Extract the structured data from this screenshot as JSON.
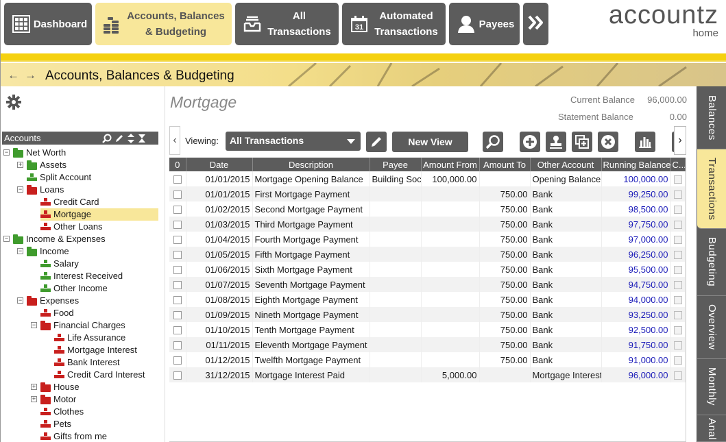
{
  "nav": {
    "buttons": [
      {
        "label": "Dashboard",
        "icon": "dashboard-grid-icon"
      },
      {
        "label": "Accounts, Balances\n& Budgeting",
        "icon": "coins-icon"
      },
      {
        "label": "All\nTransactions",
        "icon": "inbox-tray-icon"
      },
      {
        "label": "Automated\nTransactions",
        "icon": "calendar-31-icon"
      },
      {
        "label": "Payees",
        "icon": "person-icon"
      },
      {
        "label": "",
        "icon": "double-chevron-right-icon"
      }
    ],
    "active": "Accounts, Balances\n& Budgeting"
  },
  "logo": {
    "name": "accountz",
    "sub": "home"
  },
  "breadcrumb": {
    "title": "Accounts, Balances & Budgeting"
  },
  "tree": {
    "header": "Accounts",
    "nodes": [
      {
        "label": "Net Worth",
        "kind": "folder-green",
        "expander": "−",
        "depth": 0
      },
      {
        "label": "Assets",
        "kind": "folder-green",
        "expander": "+",
        "depth": 1
      },
      {
        "label": "Split Account",
        "kind": "acct-green",
        "expander": "",
        "depth": 1
      },
      {
        "label": "Loans",
        "kind": "folder-red",
        "expander": "−",
        "depth": 1
      },
      {
        "label": "Credit Card",
        "kind": "acct-red",
        "expander": "",
        "depth": 2
      },
      {
        "label": "Mortgage",
        "kind": "acct-red",
        "expander": "",
        "depth": 2,
        "selected": true
      },
      {
        "label": "Other Loans",
        "kind": "acct-red",
        "expander": "",
        "depth": 2
      },
      {
        "label": "Income & Expenses",
        "kind": "folder-green",
        "expander": "−",
        "depth": 0
      },
      {
        "label": "Income",
        "kind": "folder-green",
        "expander": "−",
        "depth": 1
      },
      {
        "label": "Salary",
        "kind": "acct-green",
        "expander": "",
        "depth": 2
      },
      {
        "label": "Interest Received",
        "kind": "acct-green",
        "expander": "",
        "depth": 2
      },
      {
        "label": "Other Income",
        "kind": "acct-green",
        "expander": "",
        "depth": 2
      },
      {
        "label": "Expenses",
        "kind": "folder-red",
        "expander": "−",
        "depth": 1
      },
      {
        "label": "Food",
        "kind": "acct-red",
        "expander": "",
        "depth": 2
      },
      {
        "label": "Financial Charges",
        "kind": "folder-red",
        "expander": "−",
        "depth": 2
      },
      {
        "label": "Life Assurance",
        "kind": "acct-red",
        "expander": "",
        "depth": 3
      },
      {
        "label": "Mortgage Interest",
        "kind": "acct-red",
        "expander": "",
        "depth": 3
      },
      {
        "label": "Bank Interest",
        "kind": "acct-red",
        "expander": "",
        "depth": 3
      },
      {
        "label": "Credit Card Interest",
        "kind": "acct-red",
        "expander": "",
        "depth": 3
      },
      {
        "label": "House",
        "kind": "folder-red",
        "expander": "+",
        "depth": 2
      },
      {
        "label": "Motor",
        "kind": "folder-red",
        "expander": "+",
        "depth": 2
      },
      {
        "label": "Clothes",
        "kind": "acct-red",
        "expander": "",
        "depth": 2
      },
      {
        "label": "Pets",
        "kind": "acct-red",
        "expander": "",
        "depth": 2
      },
      {
        "label": "Gifts from me",
        "kind": "acct-red",
        "expander": "",
        "depth": 2
      }
    ]
  },
  "account": {
    "title": "Mortgage",
    "current_balance_label": "Current Balance",
    "current_balance": "96,000.00",
    "statement_balance_label": "Statement Balance",
    "statement_balance": "0.00"
  },
  "toolbar": {
    "viewing_label": "Viewing:",
    "view_selected": "All Transactions",
    "new_view_label": "New View",
    "icons": [
      "pencil-icon",
      "search-icon",
      "add-icon",
      "stamp-icon",
      "duplicate-icon",
      "delete-icon",
      "bar-chart-icon"
    ]
  },
  "table": {
    "columns": [
      "0",
      "Date",
      "Description",
      "Payee",
      "Amount From",
      "Amount To",
      "Other Account",
      "Running Balance",
      "C..."
    ],
    "rows": [
      {
        "date": "01/01/2015",
        "desc": "Mortgage Opening Balance",
        "payee": "Building Soc",
        "from": "100,000.00",
        "to": "",
        "other": "Opening Balance",
        "running": "100,000.00"
      },
      {
        "date": "01/01/2015",
        "desc": "First Mortgage Payment",
        "payee": "",
        "from": "",
        "to": "750.00",
        "other": "Bank",
        "running": "99,250.00"
      },
      {
        "date": "01/02/2015",
        "desc": "Second Mortgage Payment",
        "payee": "",
        "from": "",
        "to": "750.00",
        "other": "Bank",
        "running": "98,500.00"
      },
      {
        "date": "01/03/2015",
        "desc": "Third Mortgage Payment",
        "payee": "",
        "from": "",
        "to": "750.00",
        "other": "Bank",
        "running": "97,750.00"
      },
      {
        "date": "01/04/2015",
        "desc": "Fourth Mortgage Payment",
        "payee": "",
        "from": "",
        "to": "750.00",
        "other": "Bank",
        "running": "97,000.00"
      },
      {
        "date": "01/05/2015",
        "desc": "Fifth Mortgage Payment",
        "payee": "",
        "from": "",
        "to": "750.00",
        "other": "Bank",
        "running": "96,250.00"
      },
      {
        "date": "01/06/2015",
        "desc": "Sixth Mortgage Payment",
        "payee": "",
        "from": "",
        "to": "750.00",
        "other": "Bank",
        "running": "95,500.00"
      },
      {
        "date": "01/07/2015",
        "desc": "Seventh Mortgage Payment",
        "payee": "",
        "from": "",
        "to": "750.00",
        "other": "Bank",
        "running": "94,750.00"
      },
      {
        "date": "01/08/2015",
        "desc": "Eighth Mortgage Payment",
        "payee": "",
        "from": "",
        "to": "750.00",
        "other": "Bank",
        "running": "94,000.00"
      },
      {
        "date": "01/09/2015",
        "desc": "Nineth Mortgage Payment",
        "payee": "",
        "from": "",
        "to": "750.00",
        "other": "Bank",
        "running": "93,250.00"
      },
      {
        "date": "01/10/2015",
        "desc": "Tenth Mortgage Payment",
        "payee": "",
        "from": "",
        "to": "750.00",
        "other": "Bank",
        "running": "92,500.00"
      },
      {
        "date": "01/11/2015",
        "desc": "Eleventh Mortgage Payment",
        "payee": "",
        "from": "",
        "to": "750.00",
        "other": "Bank",
        "running": "91,750.00"
      },
      {
        "date": "01/12/2015",
        "desc": "Twelfth Mortgage Payment",
        "payee": "",
        "from": "",
        "to": "750.00",
        "other": "Bank",
        "running": "91,000.00"
      },
      {
        "date": "31/12/2015",
        "desc": "Mortgage Interest Paid",
        "payee": "",
        "from": "5,000.00",
        "to": "",
        "other": "Mortgage Interest",
        "running": "96,000.00"
      }
    ]
  },
  "side_tabs": [
    {
      "label": "Balances"
    },
    {
      "label": "Transactions",
      "active": true
    },
    {
      "label": "Budgeting"
    },
    {
      "label": "Overview"
    },
    {
      "label": "Monthly"
    },
    {
      "label": "Anal"
    }
  ],
  "colors": {
    "nav_bg": "#5c5c5c",
    "active_yellow": "#f8e79a",
    "accent_bar": "#f5d10f",
    "running_balance": "#1a1ab8",
    "folder_green": "#3f9b2d",
    "folder_red": "#c8201e"
  }
}
